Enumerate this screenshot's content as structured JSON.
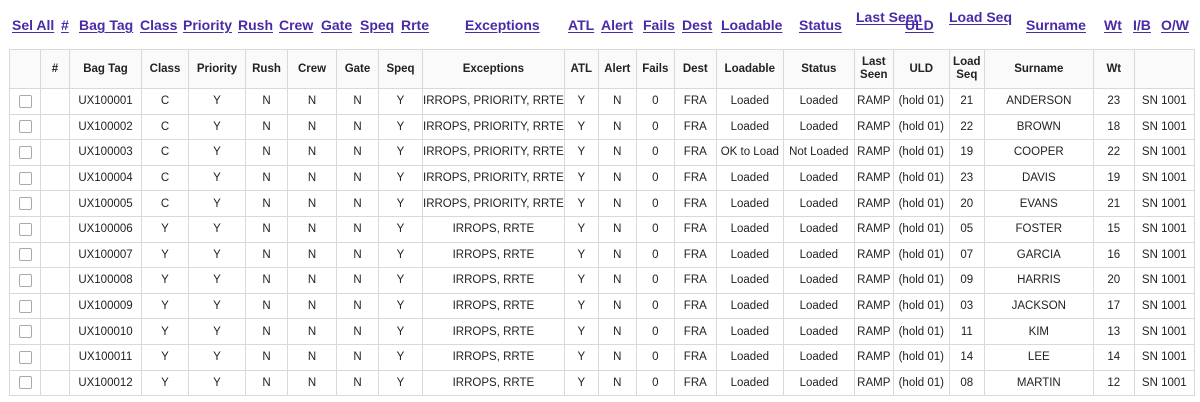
{
  "sort_links": [
    {
      "key": "sel_all",
      "label": "Sel All"
    },
    {
      "key": "num",
      "label": "#"
    },
    {
      "key": "bag_tag",
      "label": "Bag Tag"
    },
    {
      "key": "class",
      "label": "Class"
    },
    {
      "key": "priority",
      "label": "Priority"
    },
    {
      "key": "rush",
      "label": "Rush"
    },
    {
      "key": "crew",
      "label": "Crew"
    },
    {
      "key": "gate",
      "label": "Gate"
    },
    {
      "key": "speq",
      "label": "Speq"
    },
    {
      "key": "rrte",
      "label": "Rrte"
    },
    {
      "key": "exceptions",
      "label": "Exceptions"
    },
    {
      "key": "atl",
      "label": "ATL"
    },
    {
      "key": "alert",
      "label": "Alert"
    },
    {
      "key": "fails",
      "label": "Fails"
    },
    {
      "key": "dest",
      "label": "Dest"
    },
    {
      "key": "loadable",
      "label": "Loadable"
    },
    {
      "key": "status",
      "label": "Status"
    },
    {
      "key": "last_seen",
      "label": "Last Seen"
    },
    {
      "key": "uld",
      "label": "ULD"
    },
    {
      "key": "load_seq",
      "label": "Load Seq"
    },
    {
      "key": "surname",
      "label": "Surname"
    },
    {
      "key": "wt",
      "label": "Wt"
    },
    {
      "key": "ib",
      "label": "I/B"
    },
    {
      "key": "ow",
      "label": "O/W"
    }
  ],
  "columns": [
    "",
    "#",
    "Bag Tag",
    "Class",
    "Priority",
    "Rush",
    "Crew",
    "Gate",
    "Speq",
    "Exceptions",
    "ATL",
    "Alert",
    "Fails",
    "Dest",
    "Loadable",
    "Status",
    "Last Seen",
    "ULD",
    "Load Seq",
    "Surname",
    "Wt",
    ""
  ],
  "rows": [
    {
      "num": "",
      "bag_tag": "UX100001",
      "class": "C",
      "priority": "Y",
      "rush": "N",
      "crew": "N",
      "gate": "N",
      "speq": "Y",
      "exceptions": "IRROPS, PRIORITY, RRTE",
      "atl": "Y",
      "alert": "N",
      "fails": "0",
      "dest": "FRA",
      "loadable": "Loaded",
      "status": "Loaded",
      "last_seen": "RAMP",
      "uld": "(hold 01)",
      "load_seq": "21",
      "surname": "ANDERSON",
      "wt": "23",
      "flight": "SN 1001"
    },
    {
      "num": "",
      "bag_tag": "UX100002",
      "class": "C",
      "priority": "Y",
      "rush": "N",
      "crew": "N",
      "gate": "N",
      "speq": "Y",
      "exceptions": "IRROPS, PRIORITY, RRTE",
      "atl": "Y",
      "alert": "N",
      "fails": "0",
      "dest": "FRA",
      "loadable": "Loaded",
      "status": "Loaded",
      "last_seen": "RAMP",
      "uld": "(hold 01)",
      "load_seq": "22",
      "surname": "BROWN",
      "wt": "18",
      "flight": "SN 1001"
    },
    {
      "num": "",
      "bag_tag": "UX100003",
      "class": "C",
      "priority": "Y",
      "rush": "N",
      "crew": "N",
      "gate": "N",
      "speq": "Y",
      "exceptions": "IRROPS, PRIORITY, RRTE",
      "atl": "Y",
      "alert": "N",
      "fails": "0",
      "dest": "FRA",
      "loadable": "OK to Load",
      "status": "Not Loaded",
      "last_seen": "RAMP",
      "uld": "(hold 01)",
      "load_seq": "19",
      "surname": "COOPER",
      "wt": "22",
      "flight": "SN 1001"
    },
    {
      "num": "",
      "bag_tag": "UX100004",
      "class": "C",
      "priority": "Y",
      "rush": "N",
      "crew": "N",
      "gate": "N",
      "speq": "Y",
      "exceptions": "IRROPS, PRIORITY, RRTE",
      "atl": "Y",
      "alert": "N",
      "fails": "0",
      "dest": "FRA",
      "loadable": "Loaded",
      "status": "Loaded",
      "last_seen": "RAMP",
      "uld": "(hold 01)",
      "load_seq": "23",
      "surname": "DAVIS",
      "wt": "19",
      "flight": "SN 1001"
    },
    {
      "num": "",
      "bag_tag": "UX100005",
      "class": "C",
      "priority": "Y",
      "rush": "N",
      "crew": "N",
      "gate": "N",
      "speq": "Y",
      "exceptions": "IRROPS, PRIORITY, RRTE",
      "atl": "Y",
      "alert": "N",
      "fails": "0",
      "dest": "FRA",
      "loadable": "Loaded",
      "status": "Loaded",
      "last_seen": "RAMP",
      "uld": "(hold 01)",
      "load_seq": "20",
      "surname": "EVANS",
      "wt": "21",
      "flight": "SN 1001"
    },
    {
      "num": "",
      "bag_tag": "UX100006",
      "class": "Y",
      "priority": "Y",
      "rush": "N",
      "crew": "N",
      "gate": "N",
      "speq": "Y",
      "exceptions": "IRROPS, RRTE",
      "atl": "Y",
      "alert": "N",
      "fails": "0",
      "dest": "FRA",
      "loadable": "Loaded",
      "status": "Loaded",
      "last_seen": "RAMP",
      "uld": "(hold 01)",
      "load_seq": "05",
      "surname": "FOSTER",
      "wt": "15",
      "flight": "SN 1001"
    },
    {
      "num": "",
      "bag_tag": "UX100007",
      "class": "Y",
      "priority": "Y",
      "rush": "N",
      "crew": "N",
      "gate": "N",
      "speq": "Y",
      "exceptions": "IRROPS, RRTE",
      "atl": "Y",
      "alert": "N",
      "fails": "0",
      "dest": "FRA",
      "loadable": "Loaded",
      "status": "Loaded",
      "last_seen": "RAMP",
      "uld": "(hold 01)",
      "load_seq": "07",
      "surname": "GARCIA",
      "wt": "16",
      "flight": "SN 1001"
    },
    {
      "num": "",
      "bag_tag": "UX100008",
      "class": "Y",
      "priority": "Y",
      "rush": "N",
      "crew": "N",
      "gate": "N",
      "speq": "Y",
      "exceptions": "IRROPS, RRTE",
      "atl": "Y",
      "alert": "N",
      "fails": "0",
      "dest": "FRA",
      "loadable": "Loaded",
      "status": "Loaded",
      "last_seen": "RAMP",
      "uld": "(hold 01)",
      "load_seq": "09",
      "surname": "HARRIS",
      "wt": "20",
      "flight": "SN 1001"
    },
    {
      "num": "",
      "bag_tag": "UX100009",
      "class": "Y",
      "priority": "Y",
      "rush": "N",
      "crew": "N",
      "gate": "N",
      "speq": "Y",
      "exceptions": "IRROPS, RRTE",
      "atl": "Y",
      "alert": "N",
      "fails": "0",
      "dest": "FRA",
      "loadable": "Loaded",
      "status": "Loaded",
      "last_seen": "RAMP",
      "uld": "(hold 01)",
      "load_seq": "03",
      "surname": "JACKSON",
      "wt": "17",
      "flight": "SN 1001"
    },
    {
      "num": "",
      "bag_tag": "UX100010",
      "class": "Y",
      "priority": "Y",
      "rush": "N",
      "crew": "N",
      "gate": "N",
      "speq": "Y",
      "exceptions": "IRROPS, RRTE",
      "atl": "Y",
      "alert": "N",
      "fails": "0",
      "dest": "FRA",
      "loadable": "Loaded",
      "status": "Loaded",
      "last_seen": "RAMP",
      "uld": "(hold 01)",
      "load_seq": "11",
      "surname": "KIM",
      "wt": "13",
      "flight": "SN 1001"
    },
    {
      "num": "",
      "bag_tag": "UX100011",
      "class": "Y",
      "priority": "Y",
      "rush": "N",
      "crew": "N",
      "gate": "N",
      "speq": "Y",
      "exceptions": "IRROPS, RRTE",
      "atl": "Y",
      "alert": "N",
      "fails": "0",
      "dest": "FRA",
      "loadable": "Loaded",
      "status": "Loaded",
      "last_seen": "RAMP",
      "uld": "(hold 01)",
      "load_seq": "14",
      "surname": "LEE",
      "wt": "14",
      "flight": "SN 1001"
    },
    {
      "num": "",
      "bag_tag": "UX100012",
      "class": "Y",
      "priority": "Y",
      "rush": "N",
      "crew": "N",
      "gate": "N",
      "speq": "Y",
      "exceptions": "IRROPS, RRTE",
      "atl": "Y",
      "alert": "N",
      "fails": "0",
      "dest": "FRA",
      "loadable": "Loaded",
      "status": "Loaded",
      "last_seen": "RAMP",
      "uld": "(hold 01)",
      "load_seq": "08",
      "surname": "MARTIN",
      "wt": "12",
      "flight": "SN 1001"
    }
  ]
}
